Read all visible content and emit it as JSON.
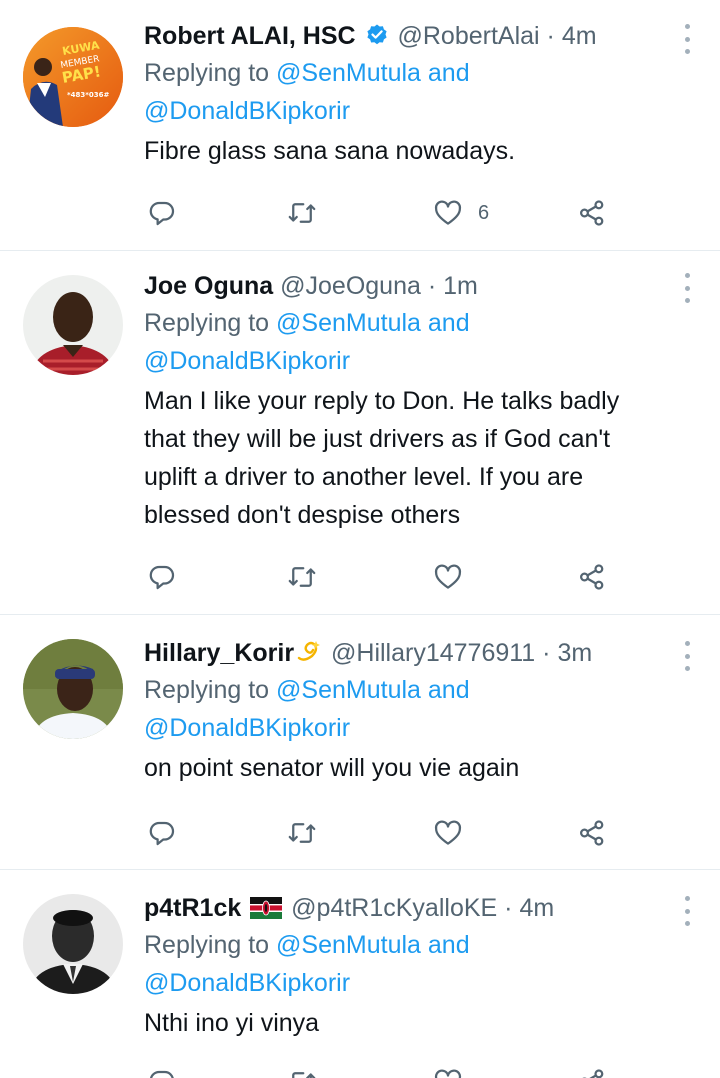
{
  "tweets": [
    {
      "name": "Robert ALAI, HSC",
      "verified": true,
      "handle": "@RobertAlai",
      "time": "4m",
      "reply_prefix": "Replying to",
      "mention1": "@SenMutula",
      "and": "and",
      "mention2": "@DonaldBKipkorir",
      "lines": [
        "Fibre glass sana sana nowadays."
      ],
      "like_count": "6",
      "avatar_text": [
        "KUWA",
        "MEMBER",
        "PAP!",
        "*483*036#"
      ]
    },
    {
      "name": "Joe Oguna",
      "handle": "@JoeOguna",
      "time": "1m",
      "reply_prefix": "Replying to",
      "mention1": "@SenMutula",
      "and": "and",
      "mention2": "@DonaldBKipkorir",
      "lines": [
        "Man I like your reply to Don. He talks badly",
        "that  they will be just drivers as if God can't",
        "uplift a driver to another level. If you are",
        "blessed don't despise others"
      ],
      "like_count": ""
    },
    {
      "name": "Hillary_Korir",
      "handle": "@Hillary14776911",
      "time": "3m",
      "reply_prefix": "Replying to",
      "mention1": "@SenMutula",
      "and": "and",
      "mention2": "@DonaldBKipkorir",
      "lines": [
        "on point senator will you vie again"
      ],
      "like_count": ""
    },
    {
      "name": "p4tR1ck",
      "handle": "@p4tR1cKyalloKE",
      "time": "4m",
      "reply_prefix": "Replying to",
      "mention1": "@SenMutula",
      "and": "and",
      "mention2": "@DonaldBKipkorir",
      "lines": [
        "Nthi ino yi vinya"
      ],
      "like_count": ""
    }
  ],
  "separator": "·",
  "icons": {
    "reply": "reply-icon",
    "retweet": "retweet-icon",
    "like": "like-icon",
    "share": "share-icon",
    "more": "more-icon",
    "verified": "verified-badge-icon",
    "dizzy": "dizzy-emoji-icon",
    "flag": "kenya-flag-icon"
  },
  "colors": {
    "text": "#0f1419",
    "secondary": "#536471",
    "link": "#1d9bf0",
    "divider": "#e6ecf0",
    "icon": "#536471"
  }
}
